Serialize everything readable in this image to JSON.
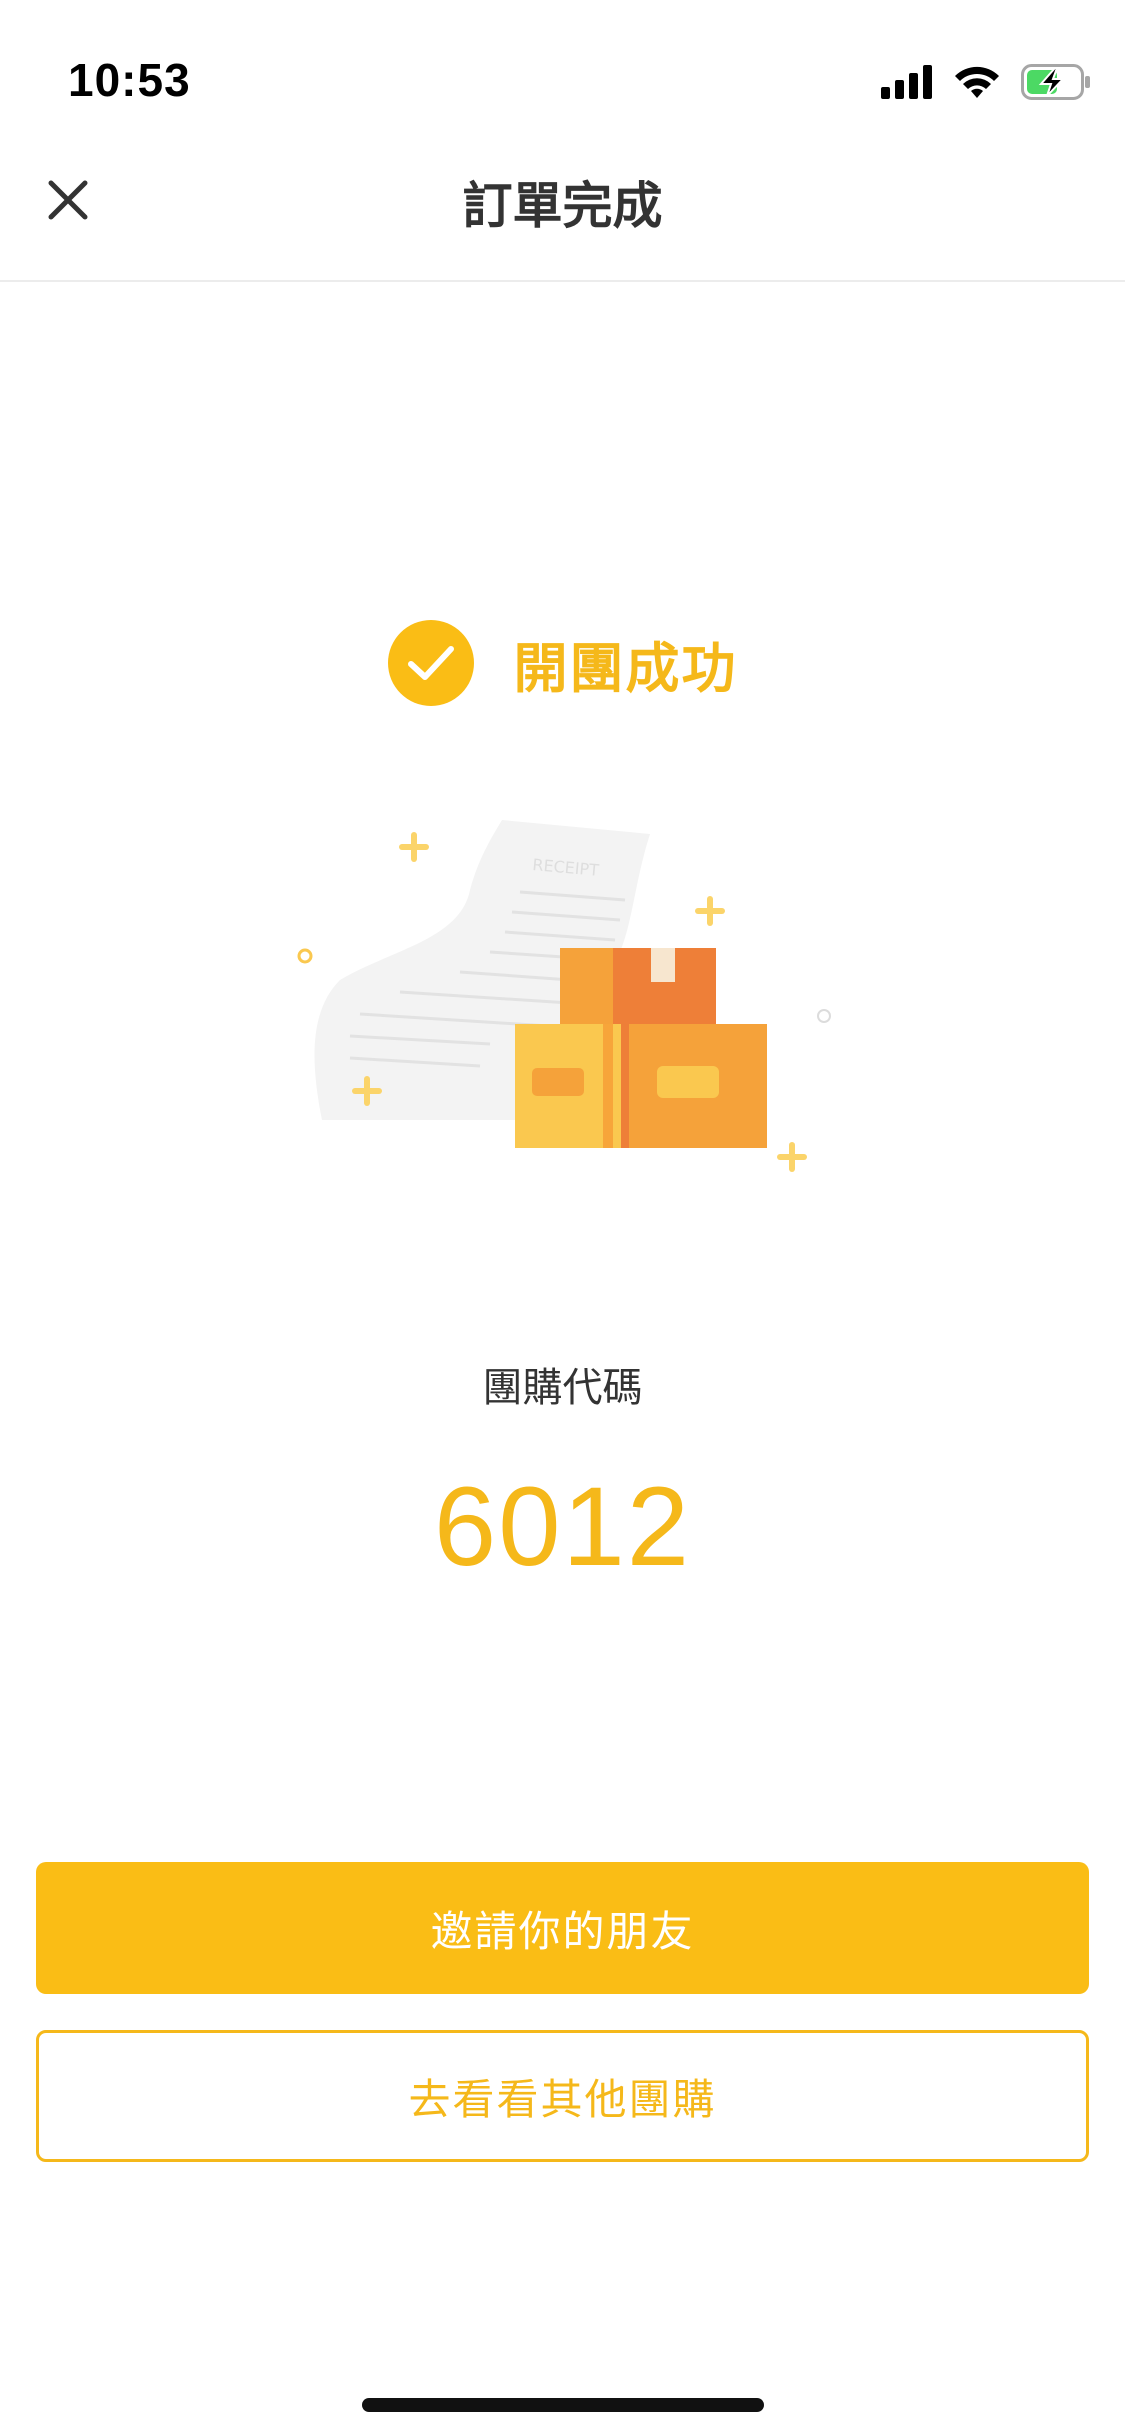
{
  "status_bar": {
    "time": "10:53",
    "icons": [
      "cellular-signal-icon",
      "wifi-icon",
      "battery-charging-icon"
    ]
  },
  "header": {
    "title": "訂單完成",
    "close_icon": "close-icon"
  },
  "success": {
    "icon": "check-circle-icon",
    "text": "開團成功"
  },
  "illustration": {
    "receipt_text": "RECEIPT",
    "description_icon": "receipt-and-boxes-illustration"
  },
  "group_code": {
    "label": "團購代碼",
    "value": "6012"
  },
  "actions": {
    "invite_label": "邀請你的朋友",
    "browse_label": "去看看其他團購"
  },
  "colors": {
    "accent": "#fabd15",
    "accent_text": "#f5b81a",
    "box_orange": "#f5a23a",
    "box_dark_orange": "#ee7f38",
    "box_yellow": "#fac84f",
    "text_dark": "#333333"
  }
}
